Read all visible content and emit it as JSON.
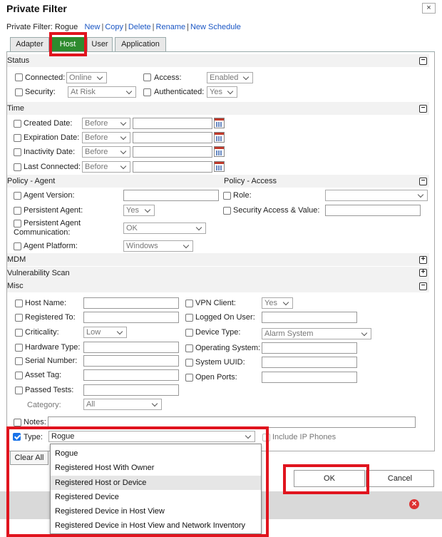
{
  "dialog": {
    "title": "Private Filter",
    "close": "×"
  },
  "filter_line": {
    "label": "Private Filter: Rogue",
    "links": [
      "New",
      "Copy",
      "Delete",
      "Rename",
      "New Schedule"
    ],
    "sep": "|"
  },
  "tabs": [
    "Adapter",
    "Host",
    "User",
    "Application"
  ],
  "colors": {
    "active_tab": "#2e8b2e",
    "highlight": "#e0141e",
    "link": "#1a56c4"
  },
  "status": {
    "header": "Status",
    "connected": "Connected:",
    "connected_val": "Online",
    "access": "Access:",
    "access_val": "Enabled",
    "security": "Security:",
    "security_val": "At Risk",
    "authenticated": "Authenticated:",
    "authenticated_val": "Yes"
  },
  "time": {
    "header": "Time",
    "rows": [
      {
        "label": "Created Date:",
        "op": "Before"
      },
      {
        "label": "Expiration Date:",
        "op": "Before"
      },
      {
        "label": "Inactivity Date:",
        "op": "Before"
      },
      {
        "label": "Last Connected:",
        "op": "Before"
      }
    ]
  },
  "policy_agent": {
    "header": "Policy - Agent",
    "version": "Agent Version:",
    "persistent": "Persistent Agent:",
    "persistent_val": "Yes",
    "comm_line1": "Persistent Agent",
    "comm_line2": "Communication:",
    "comm_val": "OK",
    "platform": "Agent Platform:",
    "platform_val": "Windows"
  },
  "policy_access": {
    "header": "Policy - Access",
    "role": "Role:",
    "security_access": "Security Access & Value:"
  },
  "mdm": {
    "header": "MDM"
  },
  "vuln": {
    "header": "Vulnerability Scan"
  },
  "misc": {
    "header": "Misc",
    "host_name": "Host Name:",
    "registered_to": "Registered To:",
    "criticality": "Criticality:",
    "criticality_val": "Low",
    "hardware_type": "Hardware Type:",
    "serial_number": "Serial Number:",
    "asset_tag": "Asset Tag:",
    "passed_tests": "Passed Tests:",
    "category": "Category:",
    "category_val": "All",
    "vpn_client": "VPN Client:",
    "vpn_client_val": "Yes",
    "logged_on_user": "Logged On User:",
    "device_type": "Device Type:",
    "device_type_val": "Alarm System",
    "operating_system": "Operating System:",
    "system_uuid": "System UUID:",
    "open_ports": "Open Ports:"
  },
  "notes": "Notes:",
  "type": {
    "label": "Type:",
    "value": "Rogue",
    "include_ip": "Include IP Phones"
  },
  "dropdown_options": [
    "Rogue",
    "Registered Host With Owner",
    "Registered Host or Device",
    "Registered Device",
    "Registered Device in Host View",
    "Registered Device in Host View and Network Inventory"
  ],
  "buttons": {
    "clear_all": "Clear All",
    "ok": "OK",
    "cancel": "Cancel"
  },
  "bottom": {
    "icon": "×"
  }
}
